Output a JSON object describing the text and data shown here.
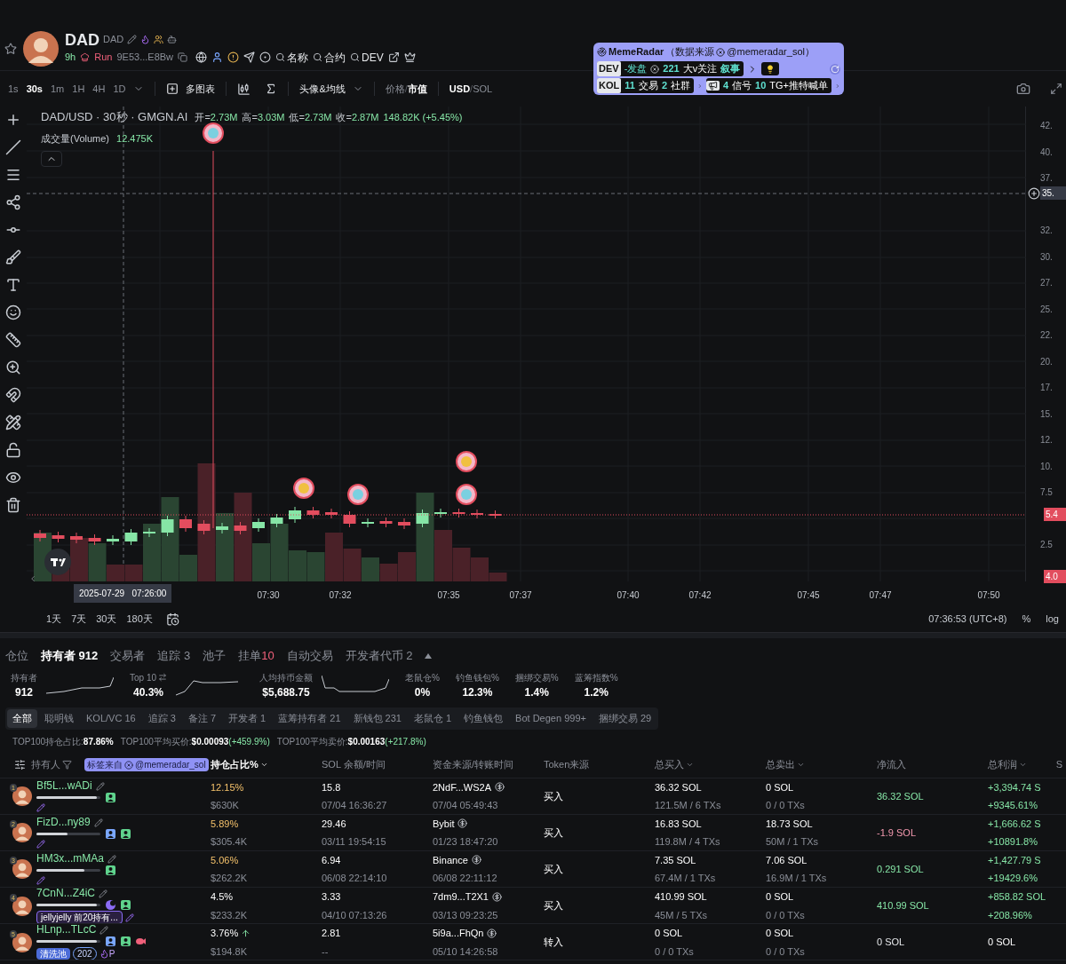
{
  "token": {
    "name": "DAD",
    "symbol": "DAD",
    "age": "9h",
    "status": "Run",
    "address": "9E53...E8Bw",
    "searches": [
      "名称",
      "合约",
      "DEV"
    ]
  },
  "radar": {
    "title": "MemeRadar",
    "source_prefix": "（数据来源",
    "source_handle": "@memeradar_sol）",
    "dev_label": "DEV",
    "dev_status": "-发盘",
    "followers": "221",
    "followers_label": "大v关注",
    "narrative": "叙事",
    "kol_label": "KOL",
    "trades": "11",
    "trades_label": "交易",
    "groups": "2",
    "groups_label": "社群",
    "signals": "4",
    "signals_label": "信号",
    "calls": "10",
    "calls_label": "TG+推特喊单"
  },
  "toolbar": {
    "intervals": [
      {
        "label": "1s",
        "selected": false
      },
      {
        "label": "30s",
        "selected": true
      },
      {
        "label": "1m",
        "selected": false
      },
      {
        "label": "1H",
        "selected": false
      },
      {
        "label": "4H",
        "selected": false
      },
      {
        "label": "1D",
        "selected": false
      }
    ],
    "multi_chart": "多图表",
    "indicators": "头像&均线",
    "price_modes": [
      {
        "label": "价格",
        "selected": false
      },
      {
        "label": "市值",
        "selected": true
      }
    ],
    "price_separator": "/",
    "currencies": [
      {
        "label": "USD",
        "selected": true
      },
      {
        "label": "SOL",
        "selected": false
      }
    ],
    "currency_separator": "/"
  },
  "legend": {
    "title": "DAD/USD · 30秒 · GMGN.AI",
    "ohlc": [
      {
        "label": "开=",
        "value": "2.73M"
      },
      {
        "label": "高=",
        "value": "3.03M"
      },
      {
        "label": "低=",
        "value": "2.73M"
      },
      {
        "label": "收=",
        "value": "2.87M"
      }
    ],
    "change": "148.82K (+5.45%)",
    "volume_label": "成交量(Volume)",
    "volume": "12.475K"
  },
  "price_axis": {
    "ticks": [
      "42.",
      "40.",
      "37.",
      "32.",
      "30.",
      "27.",
      "25.",
      "22.",
      "20.",
      "17.",
      "15.",
      "12.",
      "10.",
      "7.5",
      "2.5"
    ],
    "crosshair": "35.",
    "last_price": "5.4",
    "low_price": "4.0"
  },
  "time_axis": {
    "crosshair": "2025-07-29   07:26:00",
    "ticks": [
      "07:30",
      "07:32",
      "07:35",
      "07:37",
      "07:40",
      "07:42",
      "07:45",
      "07:47",
      "07:50"
    ]
  },
  "ranges": [
    "1天",
    "7天",
    "30天",
    "180天"
  ],
  "clock": "07:36:53 (UTC+8)",
  "scale_options": [
    "%",
    "log"
  ],
  "tabs": [
    {
      "label": "仓位",
      "selected": false
    },
    {
      "label": "持有者 912",
      "selected": true
    },
    {
      "label": "交易者",
      "selected": false
    },
    {
      "label": "追踪 3",
      "selected": false
    },
    {
      "label": "池子",
      "selected": false
    },
    {
      "label": "挂单",
      "badge": "10",
      "selected": false
    },
    {
      "label": "自动交易",
      "selected": false
    },
    {
      "label": "开发者代币 2",
      "selected": false
    }
  ],
  "stats": [
    {
      "label": "持有者",
      "value": "912",
      "kind": "sparkline"
    },
    {
      "label": "Top 10",
      "value": "40.3%",
      "kind": "sparkline"
    },
    {
      "label": "人均持币金额",
      "value": "$5,688.75",
      "kind": "sparkline"
    },
    {
      "label": "老鼠仓%",
      "value": "0%",
      "kind": "plain"
    },
    {
      "label": "钓鱼钱包%",
      "value": "12.3%",
      "kind": "plain"
    },
    {
      "label": "捆绑交易%",
      "value": "1.4%",
      "kind": "plain"
    },
    {
      "label": "蓝筹指数%",
      "value": "1.2%",
      "kind": "plain"
    }
  ],
  "filters": [
    {
      "label": "全部",
      "selected": true
    },
    {
      "label": "聪明钱",
      "selected": false
    },
    {
      "label": "KOL/VC 16",
      "selected": false
    },
    {
      "label": "追踪 3",
      "selected": false
    },
    {
      "label": "备注 7",
      "selected": false
    },
    {
      "label": "开发者 1",
      "selected": false
    },
    {
      "label": "蓝筹持有者 21",
      "selected": false
    },
    {
      "label": "新钱包 231",
      "selected": false
    },
    {
      "label": "老鼠仓 1",
      "selected": false
    },
    {
      "label": "钓鱼钱包",
      "selected": false
    },
    {
      "label": "Bot Degen 999+",
      "selected": false
    },
    {
      "label": "捆绑交易 29",
      "selected": false
    }
  ],
  "summary": [
    {
      "label": "TOP100持仓占比:",
      "value": "87.86%"
    },
    {
      "label": "TOP100平均买价:",
      "value": "$0.00093",
      "change": "(+459.9%)"
    },
    {
      "label": "TOP100平均卖价:",
      "value": "$0.00163",
      "change": "(+217.8%)"
    }
  ],
  "table": {
    "tag_source": {
      "prefix": "标签来自",
      "handle": "@memeradar_sol"
    },
    "columns": [
      {
        "label": "持有人",
        "kind": "filter",
        "active": false
      },
      {
        "label": "持仓占比%",
        "kind": "sort",
        "active": true
      },
      {
        "label": "SOL 余额/时间",
        "kind": "plain",
        "active": false
      },
      {
        "label": "资金来源/转账时间",
        "kind": "plain",
        "active": false
      },
      {
        "label": "Token来源",
        "kind": "plain",
        "active": false
      },
      {
        "label": "总买入",
        "kind": "sort",
        "active": false
      },
      {
        "label": "总卖出",
        "kind": "sort",
        "active": false
      },
      {
        "label": "净流入",
        "kind": "plain",
        "active": false
      },
      {
        "label": "总利润",
        "kind": "sort",
        "active": false
      },
      {
        "label": "S",
        "kind": "plain",
        "active": false
      }
    ],
    "rows": [
      {
        "rank": "1",
        "name": "Bf5L...wADi",
        "level": 0.95,
        "badges": [
          {
            "kind": "user",
            "color": "#5fd38d"
          }
        ],
        "tags": [],
        "note_pen": true,
        "pct": "12.15%",
        "highlighted": true,
        "rising": false,
        "value": "$630K",
        "sol": "15.8",
        "sol_time": "07/04 16:36:27",
        "source": "2NdF...WS2A",
        "source_time": "07/04 05:49:43",
        "token_source": "买入",
        "buy": "36.32 SOL",
        "buy_detail": "121.5M / 6 TXs",
        "sell": "0 SOL",
        "sell_detail": "0 / 0 TXs",
        "net": "36.32 SOL",
        "positive": true,
        "negative": false,
        "profit": "+3,394.74 S",
        "profit_pct": "+9345.61%"
      },
      {
        "rank": "2",
        "name": "FizD...ny89",
        "level": 0.48,
        "badges": [
          {
            "kind": "user",
            "color": "#7aa7ff"
          },
          {
            "kind": "user",
            "color": "#5fd38d"
          }
        ],
        "tags": [],
        "note_pen": true,
        "pct": "5.89%",
        "highlighted": true,
        "rising": false,
        "value": "$305.4K",
        "sol": "29.46",
        "sol_time": "03/11 19:54:15",
        "source": "Bybit",
        "source_time": "01/23 18:47:20",
        "token_source": "买入",
        "buy": "16.83 SOL",
        "buy_detail": "119.8M / 4 TXs",
        "sell": "18.73 SOL",
        "sell_detail": "50M / 1 TXs",
        "net": "-1.9 SOL",
        "positive": false,
        "negative": true,
        "profit": "+1,666.62 S",
        "profit_pct": "+10891.8%"
      },
      {
        "rank": "3",
        "name": "HM3x...mMAa",
        "level": 0.75,
        "badges": [
          {
            "kind": "user",
            "color": "#5fd38d"
          }
        ],
        "tags": [],
        "note_pen": true,
        "pct": "5.06%",
        "highlighted": true,
        "rising": false,
        "value": "$262.2K",
        "sol": "6.94",
        "sol_time": "06/08 22:14:10",
        "source": "Binance",
        "source_time": "06/08 22:11:12",
        "token_source": "买入",
        "buy": "7.35 SOL",
        "buy_detail": "67.4M / 1 TXs",
        "sell": "7.06 SOL",
        "sell_detail": "16.9M / 1 TXs",
        "net": "0.291 SOL",
        "positive": true,
        "negative": false,
        "profit": "+1,427.79 S",
        "profit_pct": "+19429.6%"
      },
      {
        "rank": "4",
        "name": "7CnN...Z4iC",
        "level": 0.95,
        "badges": [
          {
            "kind": "moon",
            "color": "#8b6cf6"
          },
          {
            "kind": "user",
            "color": "#5fd38d"
          }
        ],
        "tags": [
          {
            "kind": "note",
            "text": "jellyjelly 前20持有..."
          }
        ],
        "note_pen": true,
        "pct": "4.5%",
        "highlighted": false,
        "rising": false,
        "value": "$233.2K",
        "sol": "3.33",
        "sol_time": "04/10 07:13:26",
        "source": "7dm9...T2X1",
        "source_time": "03/13 09:23:25",
        "token_source": "买入",
        "buy": "410.99 SOL",
        "buy_detail": "45M / 5 TXs",
        "sell": "0 SOL",
        "sell_detail": "0 / 0 TXs",
        "net": "410.99 SOL",
        "positive": true,
        "negative": false,
        "profit": "+858.82 SOL",
        "profit_pct": "+208.96%"
      },
      {
        "rank": "5",
        "name": "HLnp...TLcC",
        "level": 0.95,
        "badges": [
          {
            "kind": "user",
            "color": "#7aa7ff"
          },
          {
            "kind": "user",
            "color": "#5fd38d"
          },
          {
            "kind": "fish",
            "color": "#f0607a"
          }
        ],
        "tags": [
          {
            "kind": "label",
            "text": "清洗池"
          },
          {
            "kind": "count",
            "text": "202"
          },
          {
            "kind": "flame",
            "text": "P"
          }
        ],
        "note_pen": false,
        "pct": "3.76%",
        "highlighted": false,
        "rising": true,
        "value": "$194.8K",
        "sol": "2.81",
        "sol_time": "--",
        "source": "5i9a...FhQn",
        "source_time": "05/10 14:26:58",
        "token_source": "转入",
        "buy": "0 SOL",
        "buy_detail": "0 / 0 TXs",
        "sell": "0 SOL",
        "sell_detail": "0 / 0 TXs",
        "net": "0 SOL",
        "positive": false,
        "negative": false,
        "profit": "0 SOL"
      }
    ]
  }
}
